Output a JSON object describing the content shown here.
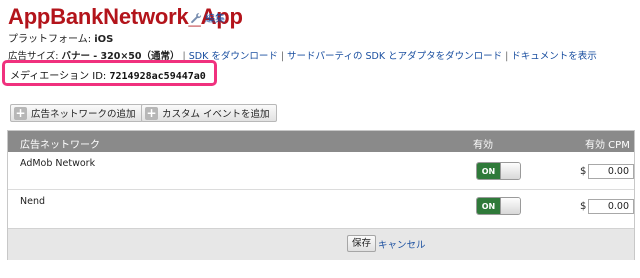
{
  "app": {
    "title": "AppBankNetwork_App",
    "edit_label": "編集"
  },
  "platform": {
    "label": "プラットフォーム: ",
    "value": "iOS"
  },
  "links": {
    "ad_size_label": "広告サイズ: ",
    "ad_size_value": "バナー - 320×50（通常）",
    "sdk_download": "SDK をダウンロード",
    "third_party_sdk": "サードパーティの SDK とアダプタをダウンロード",
    "documentation": "ドキュメントを表示"
  },
  "mediation": {
    "label": "メディエーション ID: ",
    "id": "7214928ac59447a0",
    "highlight_color": "#f0317e"
  },
  "buttons": {
    "add_network": "広告ネットワークの追加",
    "add_custom_event": "カスタム イベントを追加"
  },
  "table": {
    "headers": {
      "network": "広告ネットワーク",
      "enabled": "有効",
      "cpm": "有効 CPM"
    },
    "rows": [
      {
        "name": "AdMob Network",
        "toggle": "ON",
        "currency": "$",
        "cpm": "0.00"
      },
      {
        "name": "Nend",
        "toggle": "ON",
        "currency": "$",
        "cpm": "0.00"
      }
    ]
  },
  "footer": {
    "save": "保存",
    "cancel": "キャンセル"
  },
  "colors": {
    "title": "#b3141b",
    "link": "#1a4fa0",
    "toggle_on": "#2f7a3a",
    "header_bg": "#8a8a8a"
  },
  "icons": {
    "edit": "wrench-icon"
  }
}
